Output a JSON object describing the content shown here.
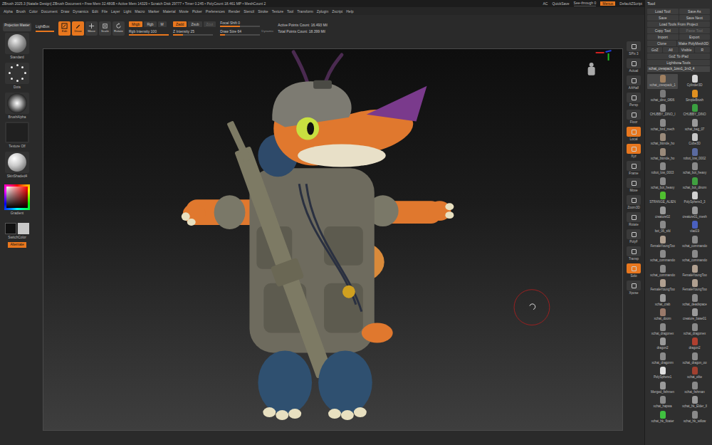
{
  "title_bar": {
    "text": "ZBrush 2025.3 [Natalie Design] ZBrush Document • Free Mem 32.480B • Active Mem 14329 • Scratch Disk 29777 • Timer 0.245 • PolyCount 18.461 MP • MeshCount 2",
    "ac": "AC",
    "quicksave": "QuickSave",
    "seethrough": {
      "label": "See-through 0",
      "level": 0
    },
    "menus": {
      "label": "Menus",
      "on": true
    },
    "script": "DefaultZScript"
  },
  "menu": [
    "Alpha",
    "Brush",
    "Color",
    "Document",
    "Draw",
    "Dynamics",
    "Edit",
    "File",
    "Layer",
    "Light",
    "Macro",
    "Marker",
    "Material",
    "Movie",
    "Picker",
    "Preferences",
    "Render",
    "Stencil",
    "Stroke",
    "Texture",
    "Tool",
    "Transform",
    "Zplugin",
    "Zscript",
    "Help"
  ],
  "left_shelf": {
    "projection_master": "Projection Master",
    "brush": "Standard",
    "stroke": "Dots",
    "alpha": "BrushAlpha",
    "texture": "Texture Off",
    "material": "SkinShaded4",
    "gradient": "Gradient",
    "switch_color": "SwitchColor",
    "alternate": {
      "label": "Alternate",
      "on": true
    }
  },
  "toolbar": {
    "lightbox": "LightBox",
    "modes": [
      {
        "label": "Edit",
        "selected": true
      },
      {
        "label": "Draw",
        "selected": true
      },
      {
        "label": "Move",
        "selected": false
      },
      {
        "label": "Scale",
        "selected": false
      },
      {
        "label": "Rotate",
        "selected": false
      }
    ],
    "color_modes": [
      {
        "label": "Mrgb",
        "selected": true
      },
      {
        "label": "Rgb",
        "selected": false
      },
      {
        "label": "M",
        "selected": false
      }
    ],
    "rgb_intensity": {
      "label": "Rgb Intensity 100",
      "level": 1
    },
    "z_modes": [
      {
        "label": "Zadd",
        "selected": true,
        "disabled": false
      },
      {
        "label": "Zsub",
        "selected": false,
        "disabled": false
      },
      {
        "label": "Zcut",
        "selected": false,
        "disabled": true
      }
    ],
    "z_intensity": {
      "label": "Z Intensity 25",
      "level": 0.25
    },
    "focal_shift": {
      "label": "Focal Shift 0",
      "level": 0.5
    },
    "draw_size": {
      "label": "Draw Size 64",
      "level": 0.12
    },
    "dynamic": "Dynamic",
    "active_points": "Active Points Count: 16.493 Mil",
    "total_points": "Total Points Count: 18.399 Mil"
  },
  "right_shelf": [
    {
      "label": "SPix 3",
      "selected": false
    },
    {
      "label": "Actual",
      "selected": false
    },
    {
      "label": "AAHalf",
      "selected": false
    },
    {
      "label": "Persp",
      "selected": false
    },
    {
      "label": "Floor",
      "selected": false
    },
    {
      "label": "Local",
      "selected": true
    },
    {
      "label": "Xyz",
      "selected": true
    },
    {
      "label": "Frame",
      "selected": false
    },
    {
      "label": "Move",
      "selected": false
    },
    {
      "label": "Zoom3D",
      "selected": false
    },
    {
      "label": "Rotate",
      "selected": false
    },
    {
      "label": "PolyF",
      "selected": false
    },
    {
      "label": "Transp",
      "selected": false
    },
    {
      "label": "Solo",
      "selected": true
    },
    {
      "label": "Xpose",
      "selected": false
    }
  ],
  "tool_panel": {
    "title": "Tool",
    "button_rows": [
      [
        {
          "label": "Load Tool",
          "disabled": false
        },
        {
          "label": "Save As",
          "disabled": false
        }
      ],
      [
        {
          "label": "Save",
          "disabled": false
        },
        {
          "label": "Save Next",
          "disabled": false
        }
      ],
      [
        {
          "label": "Load Tools From Project",
          "disabled": false
        }
      ],
      [
        {
          "label": "Copy Tool",
          "disabled": false
        },
        {
          "label": "Paste Tool",
          "disabled": true
        }
      ],
      [
        {
          "label": "Import",
          "disabled": false
        },
        {
          "label": "Export",
          "disabled": false
        }
      ],
      [
        {
          "label": "Clone",
          "disabled": false
        },
        {
          "label": "Make PolyMesh3D",
          "disabled": false
        }
      ],
      [
        {
          "label": "GoZ",
          "disabled": false
        },
        {
          "label": "All",
          "disabled": false
        },
        {
          "label": "Visible",
          "disabled": false
        },
        {
          "label": "R",
          "disabled": false
        }
      ],
      [
        {
          "label": "GoZ To iPad",
          "disabled": false
        }
      ],
      [
        {
          "label": "Lightbox▸Tools",
          "disabled": false
        }
      ]
    ],
    "current": "xchat_crewpack_1osx1_1rx3_4",
    "items": [
      {
        "label": "xchat_crewpack_1",
        "selected": true,
        "color": "#a08060"
      },
      {
        "label": "Cylinder3D",
        "selected": false,
        "color": "#d8d8d8"
      },
      {
        "label": "xchat_dino_0806",
        "selected": false,
        "color": "#7a7a7a"
      },
      {
        "label": "SimpleBrush",
        "selected": false,
        "color": "#e09020"
      },
      {
        "label": "CHUBBY_DINO_I",
        "selected": false,
        "color": "#8a8a8a"
      },
      {
        "label": "CHUBBY_DINO",
        "selected": false,
        "color": "#3aa040"
      },
      {
        "label": "xchat_bird_mech",
        "selected": false,
        "color": "#8a8a8a"
      },
      {
        "label": "xchat_bag_07",
        "selected": false,
        "color": "#9a9a9a"
      },
      {
        "label": "xchat_blonde_ho",
        "selected": false,
        "color": "#9a8a7a"
      },
      {
        "label": "Cube3D",
        "selected": false,
        "color": "#c8c8c8"
      },
      {
        "label": "xchat_blonde_ho",
        "selected": false,
        "color": "#9a8a7a"
      },
      {
        "label": "robot_low_0002",
        "selected": false,
        "color": "#5a6aa0"
      },
      {
        "label": "robot_low_0003",
        "selected": false,
        "color": "#8a8a8a"
      },
      {
        "label": "xchat_bot_heavy",
        "selected": false,
        "color": "#8a8a8a"
      },
      {
        "label": "xchat_bot_heavy",
        "selected": false,
        "color": "#8a8a8a"
      },
      {
        "label": "xchat_bot_dinom",
        "selected": false,
        "color": "#40a040"
      },
      {
        "label": "STRANGE_ALIEN",
        "selected": false,
        "color": "#50c030"
      },
      {
        "label": "PolySphere3_3",
        "selected": false,
        "color": "#d0d0d0"
      },
      {
        "label": "creature02",
        "selected": false,
        "color": "#9a9a9a"
      },
      {
        "label": "creature01_mesh",
        "selected": false,
        "color": "#9a9a9a"
      },
      {
        "label": "bot_06_sfd",
        "selected": false,
        "color": "#8a8a8a"
      },
      {
        "label": "vlad19",
        "selected": false,
        "color": "#4a60c0"
      },
      {
        "label": "FemaleYoungToo",
        "selected": false,
        "color": "#b0a090"
      },
      {
        "label": "xchat_commando",
        "selected": false,
        "color": "#8a8a8a"
      },
      {
        "label": "xchat_commando",
        "selected": false,
        "color": "#8a8a8a"
      },
      {
        "label": "xchat_commando",
        "selected": false,
        "color": "#8a8a8a"
      },
      {
        "label": "xchat_commando",
        "selected": false,
        "color": "#8a8a8a"
      },
      {
        "label": "FemaleYoungToo",
        "selected": false,
        "color": "#b0a090"
      },
      {
        "label": "FemaleYoungToo",
        "selected": false,
        "color": "#b0a090"
      },
      {
        "label": "FemaleYoungToo",
        "selected": false,
        "color": "#b0a090"
      },
      {
        "label": "xchat_crab",
        "selected": false,
        "color": "#9a9a9a"
      },
      {
        "label": "xchat_deadspace",
        "selected": false,
        "color": "#8a8a8a"
      },
      {
        "label": "xchat_doom",
        "selected": false,
        "color": "#9a7a6a"
      },
      {
        "label": "creature_base01",
        "selected": false,
        "color": "#9a9a9a"
      },
      {
        "label": "xchat_dragonex",
        "selected": false,
        "color": "#8a8a8a"
      },
      {
        "label": "xchat_dragonex",
        "selected": false,
        "color": "#8a8a8a"
      },
      {
        "label": "dragon2",
        "selected": false,
        "color": "#9a9a9a"
      },
      {
        "label": "dragon2",
        "selected": false,
        "color": "#b04030"
      },
      {
        "label": "xchat_dragonm",
        "selected": false,
        "color": "#8a8a8a"
      },
      {
        "label": "xchat_dragon_oo",
        "selected": false,
        "color": "#8a8a8a"
      },
      {
        "label": "PolySphere1",
        "selected": false,
        "color": "#e0e0e0"
      },
      {
        "label": "xchat_elite",
        "selected": false,
        "color": "#a04030"
      },
      {
        "label": "Merged_fishmen",
        "selected": false,
        "color": "#9a9a9a"
      },
      {
        "label": "xchat_fishman",
        "selected": false,
        "color": "#8a8a8a"
      },
      {
        "label": "xchat_hapwa",
        "selected": false,
        "color": "#8a8a8a"
      },
      {
        "label": "xchat_hk_Elder_II",
        "selected": false,
        "color": "#9a9a9a"
      },
      {
        "label": "xchat_hk_floater",
        "selected": false,
        "color": "#40c040"
      },
      {
        "label": "xchat_hk_willow",
        "selected": false,
        "color": "#8a8a8a"
      }
    ]
  }
}
